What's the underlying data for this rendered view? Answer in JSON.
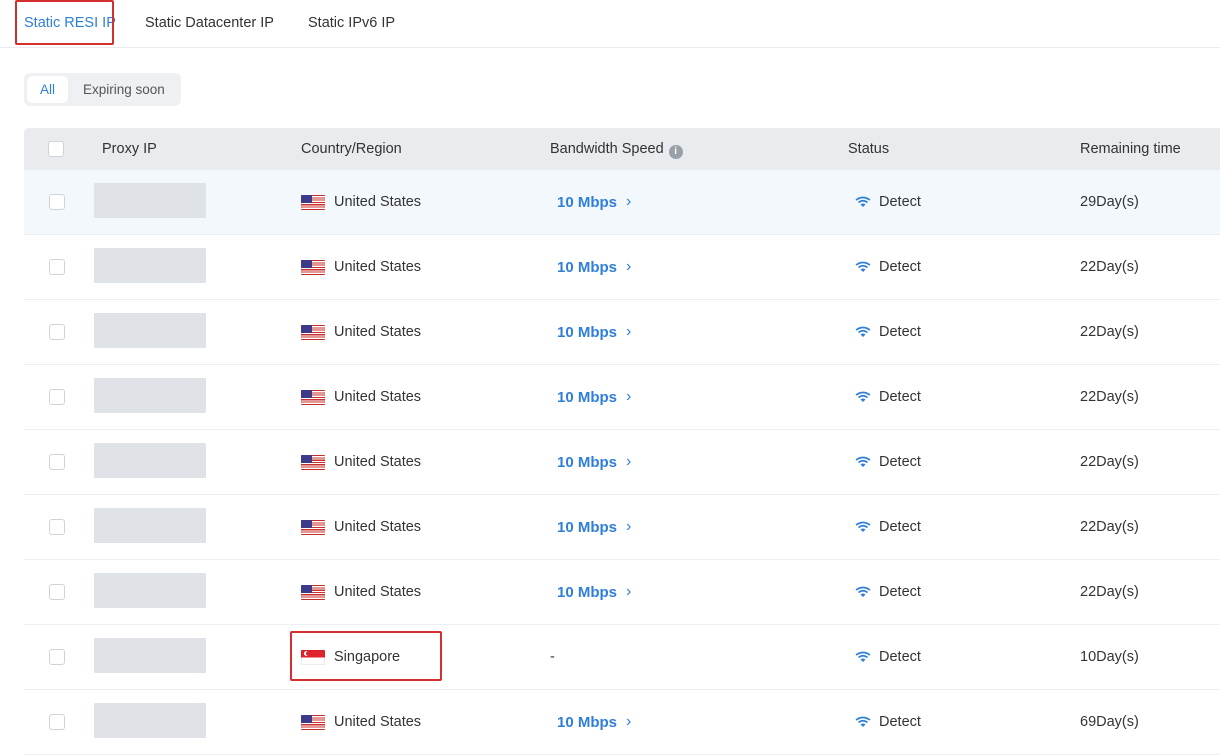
{
  "tabs": [
    {
      "label": "Static RESI IP",
      "active": true
    },
    {
      "label": "Static Datacenter IP",
      "active": false
    },
    {
      "label": "Static IPv6 IP",
      "active": false
    }
  ],
  "filter": {
    "all": "All",
    "expiring": "Expiring soon",
    "selected": "All"
  },
  "table": {
    "headers": {
      "proxy_ip": "Proxy IP",
      "country": "Country/Region",
      "bandwidth": "Bandwidth Speed",
      "status": "Status",
      "remaining": "Remaining time"
    },
    "rows": [
      {
        "flag": "us-flag",
        "country": "United States",
        "bandwidth": "10 Mbps",
        "status": "Detect",
        "remaining": "29Day(s)"
      },
      {
        "flag": "us-flag",
        "country": "United States",
        "bandwidth": "10 Mbps",
        "status": "Detect",
        "remaining": "22Day(s)"
      },
      {
        "flag": "us-flag",
        "country": "United States",
        "bandwidth": "10 Mbps",
        "status": "Detect",
        "remaining": "22Day(s)"
      },
      {
        "flag": "us-flag",
        "country": "United States",
        "bandwidth": "10 Mbps",
        "status": "Detect",
        "remaining": "22Day(s)"
      },
      {
        "flag": "us-flag",
        "country": "United States",
        "bandwidth": "10 Mbps",
        "status": "Detect",
        "remaining": "22Day(s)"
      },
      {
        "flag": "us-flag",
        "country": "United States",
        "bandwidth": "10 Mbps",
        "status": "Detect",
        "remaining": "22Day(s)"
      },
      {
        "flag": "us-flag",
        "country": "United States",
        "bandwidth": "10 Mbps",
        "status": "Detect",
        "remaining": "22Day(s)"
      },
      {
        "flag": "sg-flag",
        "country": "Singapore",
        "bandwidth": "-",
        "status": "Detect",
        "remaining": "10Day(s)"
      },
      {
        "flag": "us-flag",
        "country": "United States",
        "bandwidth": "10 Mbps",
        "status": "Detect",
        "remaining": "69Day(s)"
      }
    ]
  },
  "colors": {
    "accent": "#2f7fd8",
    "highlight_border": "#d32f2f",
    "header_bg": "#e9ebef"
  },
  "icons": {
    "info": "info-icon",
    "bandwidth_more": "chevron-right-icon",
    "detect": "wifi-signal-icon"
  }
}
